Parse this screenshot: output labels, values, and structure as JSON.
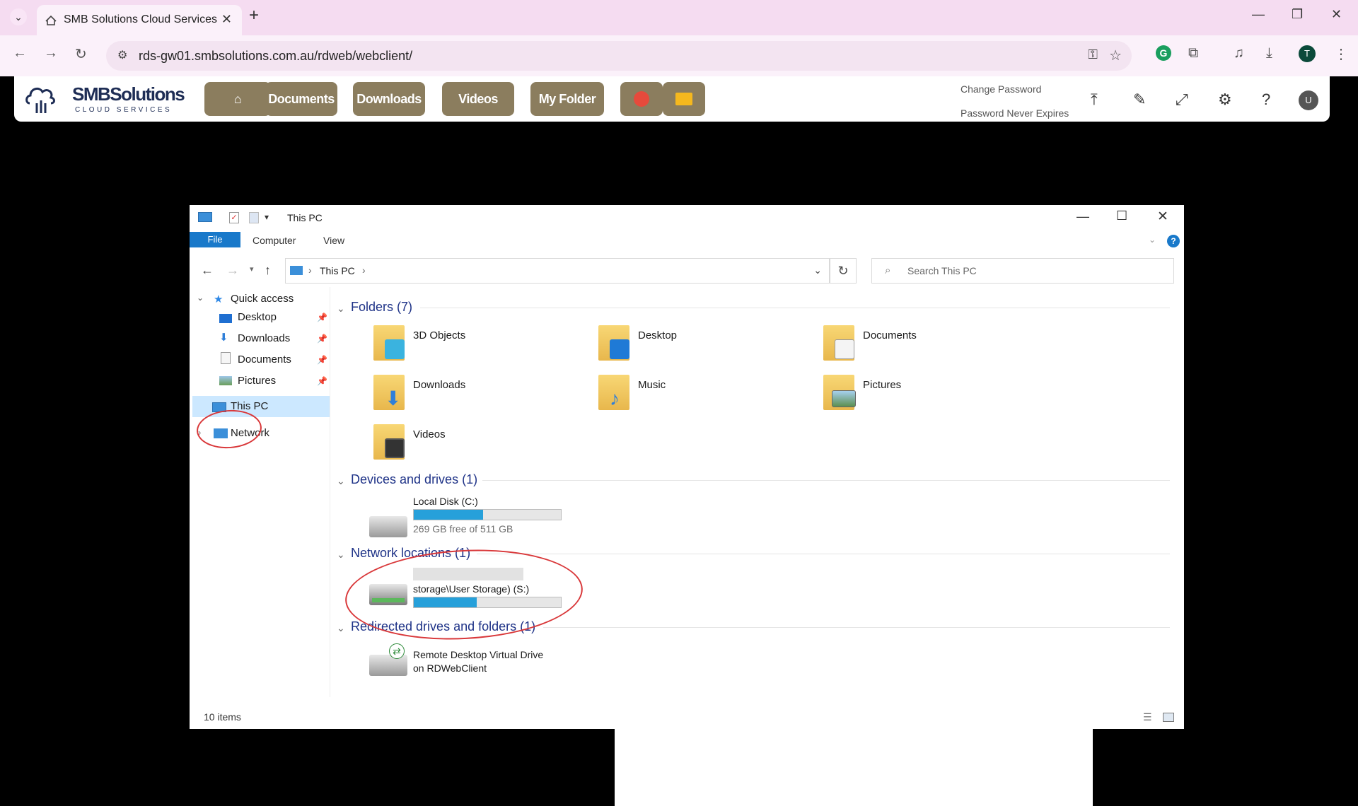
{
  "browser": {
    "tab_title": "SMB Solutions Cloud Services",
    "url": "rds-gw01.smbsolutions.com.au/rdweb/webclient/",
    "profile_initial": "T"
  },
  "header": {
    "logo_main": "SMBSolutions",
    "logo_sub": "CLOUD SERVICES",
    "buttons": [
      "Documents",
      "Downloads",
      "Videos",
      "My Folder"
    ],
    "change_password": "Change Password",
    "password_status": "Password Never Expires",
    "user_initial": "U"
  },
  "explorer": {
    "title": "This PC",
    "ribbon_tabs": [
      "File",
      "Computer",
      "View"
    ],
    "address_path": "This PC",
    "search_placeholder": "Search This PC",
    "nav": {
      "quick_access": "Quick access",
      "quick_items": [
        "Desktop",
        "Downloads",
        "Documents",
        "Pictures"
      ],
      "this_pc": "This PC",
      "network": "Network"
    },
    "groups": {
      "folders": "Folders (7)",
      "devices": "Devices and drives (1)",
      "network": "Network locations (1)",
      "redirected": "Redirected drives and folders (1)"
    },
    "folders": [
      "3D Objects",
      "Desktop",
      "Documents",
      "Downloads",
      "Music",
      "Pictures",
      "Videos"
    ],
    "local_disk": {
      "name": "Local Disk (C:)",
      "free_text": "269 GB free of 511 GB",
      "used_fraction": 0.47
    },
    "network_drive": {
      "name": "storage\\User Storage) (S:)",
      "used_fraction": 0.43
    },
    "redirected_drive": {
      "line1": "Remote Desktop Virtual Drive",
      "line2": "on RDWebClient"
    },
    "status": "10 items"
  },
  "colors": {
    "accent": "#1979ca",
    "header_button": "#8b7d5e",
    "annotation": "#d9383a"
  }
}
